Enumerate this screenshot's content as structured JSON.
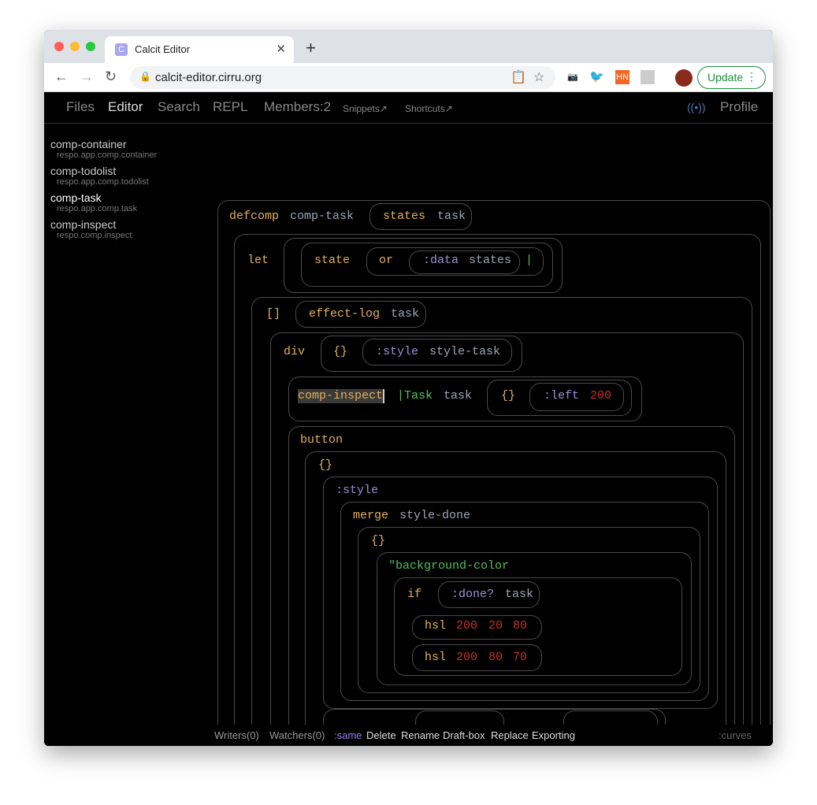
{
  "browser": {
    "tab_title": "Calcit Editor",
    "url": "calcit-editor.cirru.org",
    "update_label": "Update",
    "ext_hn": "HN"
  },
  "nav": {
    "files": "Files",
    "editor": "Editor",
    "search": "Search",
    "repl": "REPL",
    "members": "Members:2",
    "snippets": "Snippets↗",
    "shortcuts": "Shortcuts↗",
    "profile": "Profile",
    "active": "Editor"
  },
  "sidebar": {
    "items": [
      {
        "name": "comp-container",
        "ns": "respo.app.comp.container"
      },
      {
        "name": "comp-todolist",
        "ns": "respo.app.comp.todolist"
      },
      {
        "name": "comp-task",
        "ns": "respo.app.comp.task",
        "active": true
      },
      {
        "name": "comp-inspect",
        "ns": "respo.comp.inspect"
      }
    ]
  },
  "code": {
    "tokens": [
      "defcomp",
      "comp-task",
      "states",
      "task",
      "let",
      "state",
      "or",
      ":data",
      "states",
      "|",
      "[]",
      "effect-log",
      "task",
      "div",
      "{}",
      ":style",
      "style-task",
      "comp-inspect",
      "|Task",
      "task",
      "{}",
      ":left",
      "200",
      "button",
      "{}",
      ":style",
      "merge",
      "style-done",
      "{}",
      "\"background-color",
      "if",
      ":done?",
      "task",
      "hsl",
      "200",
      "20",
      "80",
      "hsl",
      "200",
      "80",
      "70"
    ]
  },
  "colors": {
    "operator": "#e4b15a",
    "symbol": "#9ea6b4",
    "keyword": "#9b8fd6",
    "string": "#52c05a",
    "number": "#c53030",
    "background": "#000000"
  },
  "bottom": {
    "writers": "Writers(0)",
    "watchers": "Watchers(0)",
    "same": ":same",
    "delete": "Delete",
    "rename": "Rename",
    "draft": "Draft-box",
    "replace": "Replace",
    "exporting": "Exporting",
    "curves": ":curves"
  }
}
